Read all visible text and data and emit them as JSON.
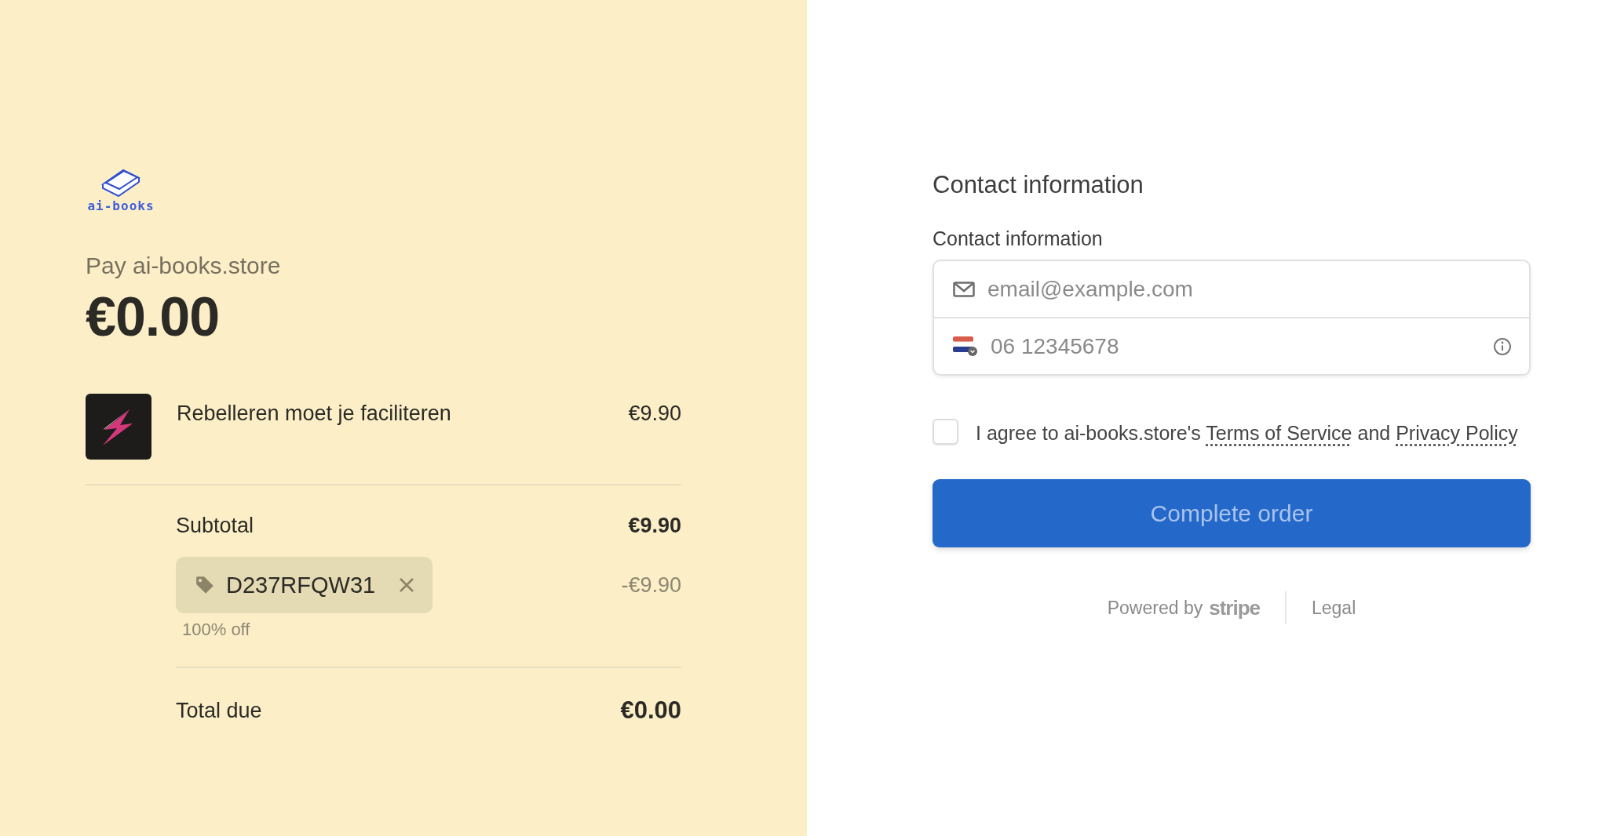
{
  "summary": {
    "logo_text": "ai-books",
    "pay_label": "Pay ai-books.store",
    "amount": "€0.00",
    "items": [
      {
        "name": "Rebelleren moet je faciliteren",
        "price": "€9.90"
      }
    ],
    "subtotal": {
      "label": "Subtotal",
      "value": "€9.90"
    },
    "coupon": {
      "code": "D237RFQW31",
      "discount": "-€9.90",
      "note": "100% off"
    },
    "total": {
      "label": "Total due",
      "value": "€0.00"
    }
  },
  "form": {
    "heading": "Contact information",
    "field_label": "Contact information",
    "email": {
      "placeholder": "email@example.com"
    },
    "phone": {
      "placeholder": "06 12345678"
    },
    "agreement": {
      "checked": false,
      "before": "I agree to ai-books.store's",
      "terms_link": "Terms of Service",
      "middle": "and",
      "privacy_link": "Privacy Policy"
    },
    "submit": {
      "label": "Complete order",
      "disabled": true
    },
    "footer": {
      "powered_by": "Powered by",
      "brand": "stripe",
      "legal": "Legal"
    }
  }
}
